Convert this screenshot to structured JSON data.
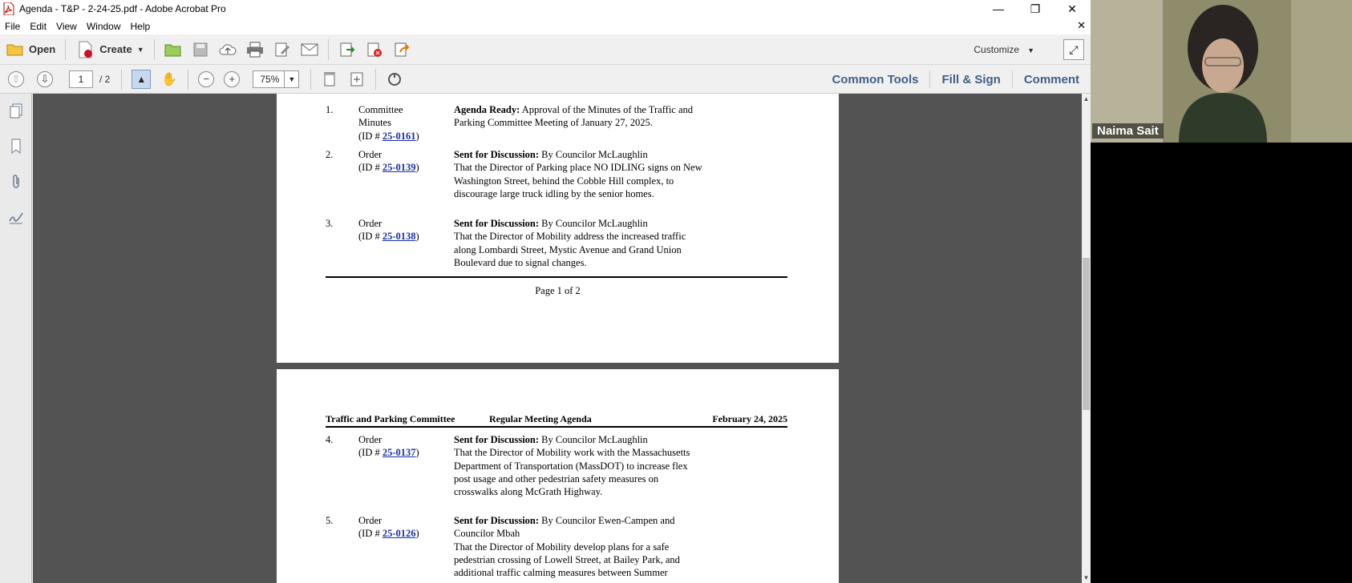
{
  "window": {
    "title": "Agenda - T&P - 2-24-25.pdf - Adobe Acrobat Pro",
    "min": "—",
    "restore": "❐",
    "close": "✕"
  },
  "menu": [
    "File",
    "Edit",
    "View",
    "Window",
    "Help"
  ],
  "menu_close": "✕",
  "toolbar": {
    "open_label": "Open",
    "create_label": "Create",
    "customize_label": "Customize"
  },
  "nav": {
    "page_current": "1",
    "page_total": "/ 2",
    "zoom": "75%"
  },
  "right_links": [
    "Common Tools",
    "Fill & Sign",
    "Comment"
  ],
  "page1": {
    "items": [
      {
        "num": "1.",
        "type": "Committee\nMinutes",
        "id_prefix": "(ID # ",
        "id": "25-0161",
        "id_suffix": ")",
        "lead": "Agenda Ready:",
        "text": " Approval of the Minutes of the Traffic and Parking Committee Meeting of January 27, 2025."
      },
      {
        "num": "2.",
        "type": "Order",
        "id_prefix": "(ID # ",
        "id": "25-0139",
        "id_suffix": ")",
        "lead": "Sent for Discussion:",
        "text": " By Councilor McLaughlin\nThat the Director of Parking place NO IDLING signs on New Washington Street, behind the Cobble Hill complex, to discourage large truck idling by the senior homes."
      },
      {
        "num": "3.",
        "type": "Order",
        "id_prefix": "(ID # ",
        "id": "25-0138",
        "id_suffix": ")",
        "lead": "Sent for Discussion:",
        "text": " By Councilor McLaughlin\nThat the Director of Mobility address the increased traffic along Lombardi Street, Mystic Avenue and Grand Union Boulevard due to signal changes."
      }
    ],
    "footer": "Page 1 of 2"
  },
  "page2": {
    "header": {
      "left": "Traffic and Parking Committee",
      "center": "Regular Meeting Agenda",
      "right": "February 24, 2025"
    },
    "items": [
      {
        "num": "4.",
        "type": "Order",
        "id_prefix": "(ID # ",
        "id": "25-0137",
        "id_suffix": ")",
        "lead": "Sent for Discussion:",
        "text": " By Councilor McLaughlin\nThat the Director of Mobility work with the Massachusetts Department of Transportation (MassDOT) to increase flex post usage and other pedestrian safety measures on crosswalks along McGrath Highway."
      },
      {
        "num": "5.",
        "type": "Order",
        "id_prefix": "(ID # ",
        "id": "25-0126",
        "id_suffix": ")",
        "lead": "Sent for Discussion:",
        "text": " By Councilor Ewen-Campen and Councilor Mbah\nThat the Director of Mobility develop plans for a safe pedestrian crossing of Lowell Street, at Bailey Park, and additional traffic calming measures between Summer"
      }
    ]
  },
  "video": {
    "participant": "Naima Sait"
  }
}
